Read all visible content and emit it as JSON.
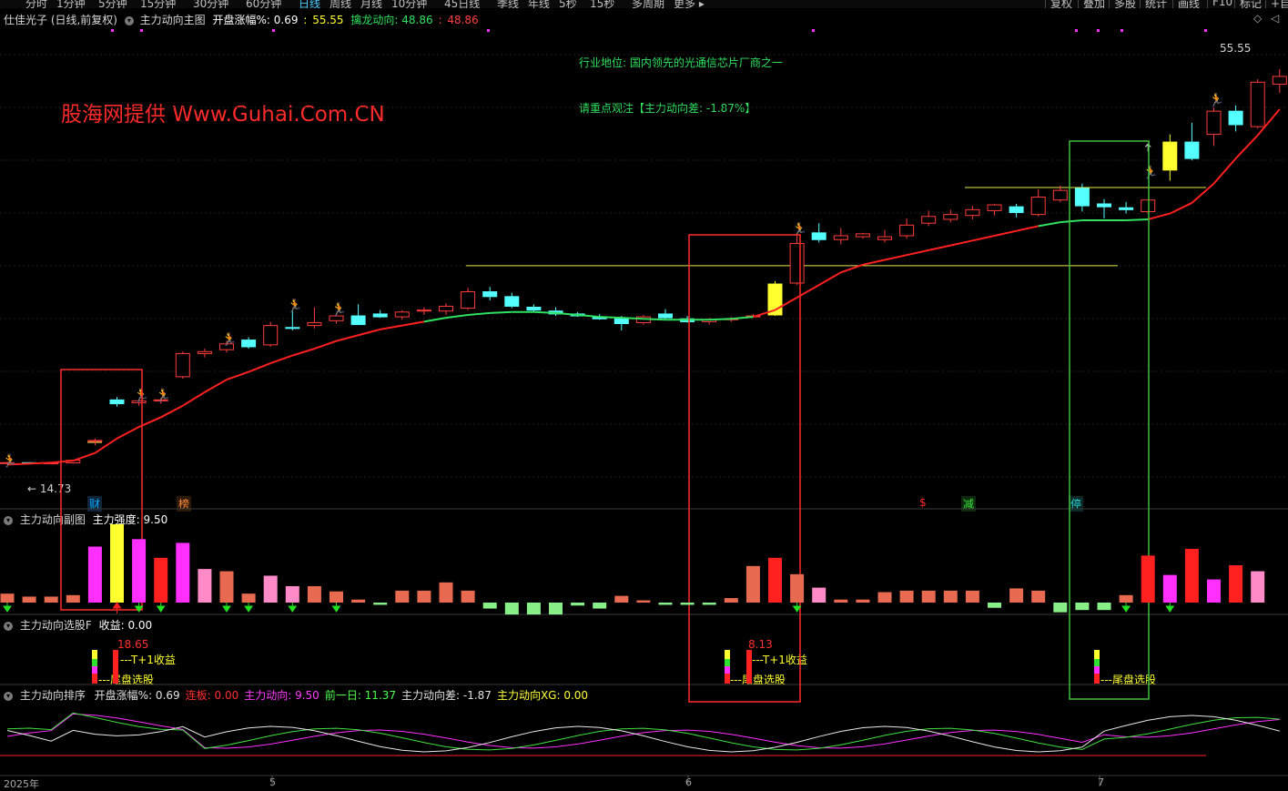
{
  "topbar": {
    "periods": [
      "分时",
      "1分钟",
      "5分钟",
      "15分钟",
      "30分钟",
      "60分钟",
      "日线",
      "周线",
      "月线",
      "10分钟",
      "45日线",
      "季线",
      "年线",
      "5秒",
      "15秒",
      "多周期",
      "更多"
    ],
    "active_period": "日线",
    "more_suffix": "▸",
    "right_buttons": [
      "复权",
      "叠加",
      "多股",
      "统计",
      "画线",
      "F10",
      "标记",
      "+自选"
    ]
  },
  "main_panel": {
    "stock_name": "仕佳光子 (日线,前复权)",
    "indicator": "主力动向主图",
    "open_pct_label": "开盘涨幅%:",
    "open_pct_value": "0.69",
    "sep": ":",
    "open_pct_price": "55.55",
    "dragon_label": "擒龙动向:",
    "dragon_value": "48.86",
    "dragon_value2": "48.86",
    "right_icons": [
      "◇",
      "◁"
    ],
    "watermark": "股海网提供 Www.Guhai.Com.CN",
    "industry_note": "行业地位: 国内领先的光通信芯片厂商之一",
    "focus_note": "请重点观注【主力动向差: -1.87%】",
    "high_price_label": "55.55",
    "low_price_label": "← 14.73",
    "event_markers": [
      {
        "text": "财",
        "color": "#00aaff"
      },
      {
        "text": "榜",
        "color": "#ff8a3a"
      },
      {
        "text": "$",
        "color": "#ff2a2a"
      },
      {
        "text": "减",
        "color": "#39e639"
      },
      {
        "text": "停",
        "color": "#2ad4d4"
      }
    ]
  },
  "sub_panel_1": {
    "indicator": "主力动向副图",
    "strength_label": "主力强度:",
    "strength_value": "9.50"
  },
  "sub_panel_2": {
    "indicator": "主力动向选股F",
    "income_label": "收益:",
    "income_value": "0.00",
    "signals": [
      {
        "value": "18.65",
        "t1": "---T+1收益",
        "tail": "---尾盘选股"
      },
      {
        "value": "8.13",
        "t1": "---T+1收益",
        "tail": "---尾盘选股"
      },
      {
        "value": "",
        "t1": "",
        "tail": "---尾盘选股"
      }
    ]
  },
  "sub_panel_3": {
    "indicator": "主力动向排序",
    "items": [
      {
        "label": "开盘涨幅%:",
        "value": "0.69",
        "color": "#e0e0e0"
      },
      {
        "label": "连板:",
        "value": "0.00",
        "color": "#ff3030"
      },
      {
        "label": "主力动向:",
        "value": "9.50",
        "color": "#ff3cff"
      },
      {
        "label": "前一日:",
        "value": "11.37",
        "color": "#4cff4c"
      },
      {
        "label": "主力动向差:",
        "value": "-1.87",
        "color": "#e0e0e0"
      },
      {
        "label": "主力动向XG:",
        "value": "0.00",
        "color": "#ffff3c"
      }
    ]
  },
  "x_axis": {
    "labels": [
      "2025年",
      "5",
      "6",
      "7"
    ]
  },
  "colors": {
    "up": "#ff3c3c",
    "down": "#54ffff",
    "ma_up": "#ff2020",
    "ma_down": "#30e060",
    "magenta": "#ff30ff",
    "yellow": "#ffff30",
    "pink": "#ff8ac8",
    "salmon": "#e86a50",
    "lightgreen": "#88ee88",
    "box_red": "#ff2a2a",
    "box_green": "#3cc03c"
  },
  "chart_data": {
    "type": "candlestick",
    "candles": [
      [
        14.73,
        14.9,
        14.6,
        14.8
      ],
      [
        14.8,
        14.85,
        14.7,
        14.75
      ],
      [
        14.75,
        14.85,
        14.65,
        14.78
      ],
      [
        14.78,
        15.1,
        14.7,
        15.05
      ],
      [
        17.0,
        17.3,
        16.6,
        17.1
      ],
      [
        21.3,
        21.6,
        20.6,
        20.9
      ],
      [
        21.0,
        21.4,
        20.7,
        21.2
      ],
      [
        21.2,
        21.5,
        20.9,
        21.3
      ],
      [
        23.7,
        26.3,
        23.5,
        26.1
      ],
      [
        26.1,
        26.6,
        25.7,
        26.3
      ],
      [
        26.5,
        27.4,
        26.2,
        27.1
      ],
      [
        27.5,
        27.8,
        26.6,
        26.8
      ],
      [
        27.0,
        29.4,
        26.8,
        29.0
      ],
      [
        28.8,
        30.6,
        28.5,
        28.7
      ],
      [
        29.0,
        30.9,
        28.7,
        29.3
      ],
      [
        29.5,
        30.3,
        29.2,
        30.0
      ],
      [
        30.0,
        31.2,
        29.8,
        29.1
      ],
      [
        30.2,
        30.6,
        29.8,
        29.9
      ],
      [
        29.9,
        30.6,
        29.6,
        30.4
      ],
      [
        30.5,
        30.9,
        30.1,
        30.6
      ],
      [
        30.5,
        31.3,
        30.1,
        31.0
      ],
      [
        30.8,
        32.9,
        30.6,
        32.5
      ],
      [
        32.5,
        33.0,
        31.6,
        32.0
      ],
      [
        32.0,
        32.4,
        30.8,
        31.0
      ],
      [
        30.9,
        31.2,
        30.4,
        30.6
      ],
      [
        30.5,
        30.9,
        30.0,
        30.2
      ],
      [
        30.2,
        30.4,
        29.9,
        30.0
      ],
      [
        29.9,
        30.2,
        29.6,
        29.7
      ],
      [
        29.7,
        30.0,
        28.5,
        29.2
      ],
      [
        29.3,
        30.1,
        29.1,
        29.9
      ],
      [
        30.2,
        30.7,
        29.7,
        29.8
      ],
      [
        29.7,
        30.0,
        29.3,
        29.4
      ],
      [
        29.4,
        29.8,
        29.1,
        29.6
      ],
      [
        29.6,
        29.9,
        29.4,
        29.7
      ],
      [
        29.9,
        30.2,
        29.8,
        30.0
      ],
      [
        30.1,
        33.6,
        30.0,
        33.3
      ],
      [
        33.4,
        38.6,
        33.2,
        37.5
      ],
      [
        38.6,
        39.6,
        37.6,
        37.9
      ],
      [
        37.9,
        39.1,
        37.4,
        38.3
      ],
      [
        38.2,
        38.6,
        38.0,
        38.5
      ],
      [
        37.9,
        38.9,
        37.6,
        38.2
      ],
      [
        38.3,
        40.1,
        38.0,
        39.4
      ],
      [
        39.6,
        40.9,
        39.3,
        40.3
      ],
      [
        40.0,
        41.0,
        39.7,
        40.5
      ],
      [
        40.4,
        41.4,
        40.0,
        41.0
      ],
      [
        40.9,
        41.6,
        40.4,
        41.5
      ],
      [
        41.3,
        41.6,
        40.2,
        40.7
      ],
      [
        40.5,
        43.1,
        40.3,
        42.3
      ],
      [
        42.0,
        43.5,
        41.8,
        43.0
      ],
      [
        43.2,
        43.7,
        40.8,
        41.4
      ],
      [
        41.6,
        42.1,
        40.1,
        41.3
      ],
      [
        41.2,
        41.8,
        40.6,
        41.0
      ],
      [
        40.8,
        42.1,
        40.6,
        42.0
      ],
      [
        48.0,
        48.8,
        44.0,
        45.1
      ],
      [
        48.0,
        50.0,
        46.1,
        46.3
      ],
      [
        48.8,
        51.6,
        47.6,
        51.2
      ],
      [
        51.2,
        51.8,
        49.1,
        49.8
      ],
      [
        49.6,
        54.5,
        49.4,
        54.2
      ],
      [
        54.0,
        55.55,
        53.1,
        54.8
      ]
    ],
    "ma_trend": [
      14.6,
      14.7,
      14.8,
      15.0,
      15.8,
      17.3,
      18.5,
      19.5,
      20.7,
      22.1,
      23.4,
      24.2,
      25.1,
      25.9,
      26.6,
      27.4,
      28.0,
      28.6,
      29.0,
      29.4,
      29.8,
      30.1,
      30.3,
      30.4,
      30.4,
      30.3,
      30.1,
      29.9,
      29.8,
      29.7,
      29.6,
      29.6,
      29.6,
      29.7,
      29.9,
      30.6,
      31.9,
      33.2,
      34.5,
      35.3,
      35.8,
      36.3,
      36.8,
      37.3,
      37.8,
      38.3,
      38.8,
      39.3,
      39.7,
      39.9,
      39.9,
      39.9,
      40.0,
      40.6,
      41.7,
      43.7,
      46.3,
      48.7,
      51.4
    ],
    "bars_main_force": [
      1.2,
      0.8,
      0.8,
      1.0,
      7.5,
      10.5,
      8.5,
      6.0,
      8.0,
      4.5,
      4.2,
      1.2,
      3.6,
      2.2,
      2.2,
      1.5,
      0.4,
      -0.3,
      1.6,
      1.6,
      2.7,
      1.6,
      -0.8,
      -1.6,
      -1.6,
      -1.6,
      -0.4,
      -0.8,
      0.9,
      0.3,
      -0.3,
      -0.3,
      -0.3,
      0.6,
      4.9,
      6.0,
      3.8,
      2.0,
      0.4,
      0.4,
      1.4,
      1.6,
      1.6,
      1.6,
      1.6,
      -0.7,
      1.9,
      1.6,
      -1.3,
      -1.0,
      -1.0,
      1.0,
      6.3,
      3.7,
      7.2,
      3.1,
      5.0,
      4.2
    ]
  }
}
